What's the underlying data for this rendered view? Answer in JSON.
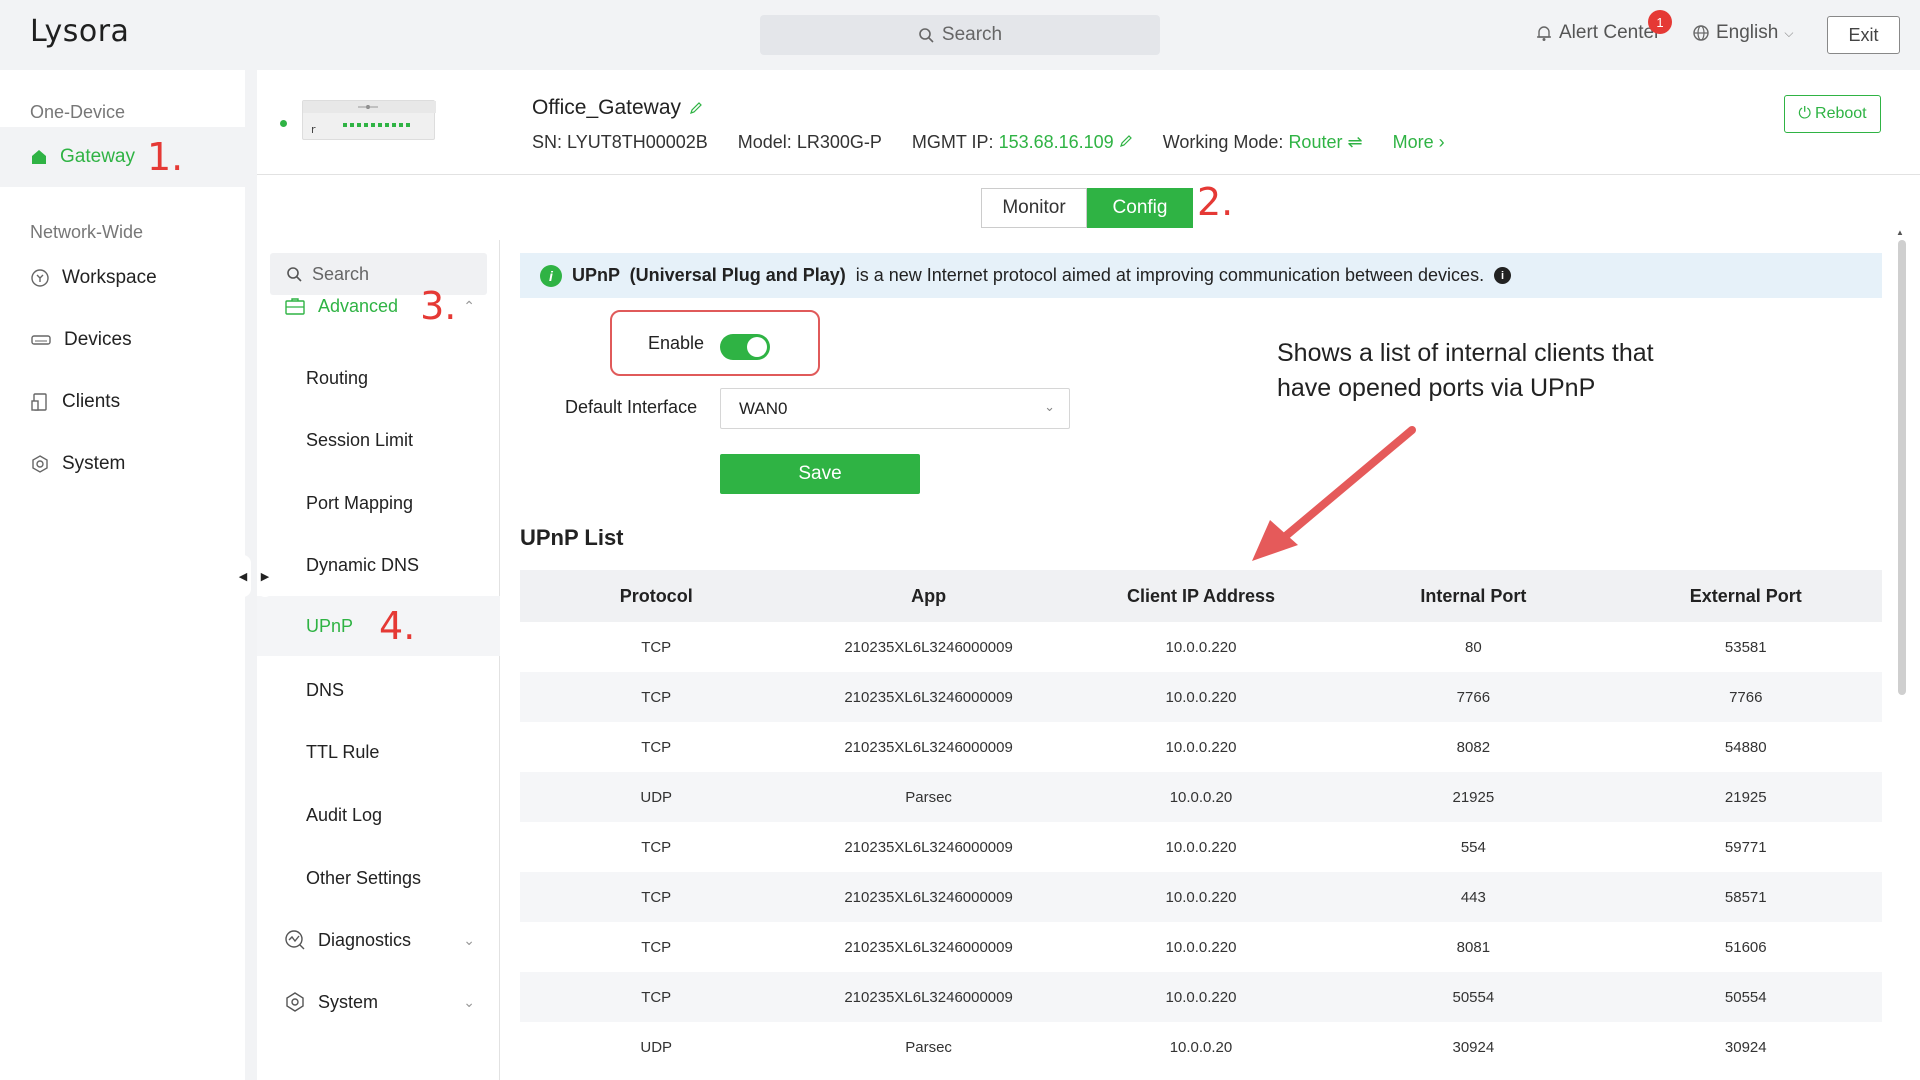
{
  "topbar": {
    "logo": "Lysora",
    "search_placeholder": "Search",
    "alert_label": "Alert Center",
    "alert_count": "1",
    "language": "English",
    "exit_label": "Exit"
  },
  "leftnav": {
    "section_one": "One-Device",
    "gateway": "Gateway",
    "section_network": "Network-Wide",
    "items": [
      {
        "label": "Workspace"
      },
      {
        "label": "Devices"
      },
      {
        "label": "Clients"
      },
      {
        "label": "System"
      }
    ]
  },
  "steps": {
    "s1": "1.",
    "s2": "2.",
    "s3": "3.",
    "s4": "4."
  },
  "device": {
    "name": "Office_Gateway",
    "sn_label": "SN:",
    "sn": "LYUT8TH00002B",
    "model_label": "Model:",
    "model": "LR300G-P",
    "mgmt_label": "MGMT IP:",
    "mgmt_ip": "153.68.16.109",
    "mode_label": "Working Mode:",
    "mode": "Router",
    "more": "More",
    "reboot": "Reboot"
  },
  "tabs": {
    "monitor": "Monitor",
    "config": "Config"
  },
  "subnav": {
    "search_placeholder": "Search",
    "advanced": "Advanced",
    "items": [
      {
        "label": "Routing"
      },
      {
        "label": "Session Limit"
      },
      {
        "label": "Port Mapping"
      },
      {
        "label": "Dynamic DNS"
      },
      {
        "label": "UPnP"
      },
      {
        "label": "DNS"
      },
      {
        "label": "TTL Rule"
      },
      {
        "label": "Audit Log"
      },
      {
        "label": "Other Settings"
      }
    ],
    "diagnostics": "Diagnostics",
    "system": "System"
  },
  "upnp": {
    "banner_bold": "UPnP  (Universal Plug and Play)",
    "banner_text": "is a new Internet protocol aimed at improving communication between devices.",
    "enable_label": "Enable",
    "enabled": true,
    "default_interface_label": "Default Interface",
    "default_interface_value": "WAN0",
    "save_label": "Save",
    "annotation_line1": "Shows a list of internal clients that",
    "annotation_line2": "have opened ports via UPnP",
    "list_title": "UPnP List",
    "columns": [
      "Protocol",
      "App",
      "Client IP Address",
      "Internal Port",
      "External Port"
    ],
    "rows": [
      [
        "TCP",
        "210235XL6L3246000009",
        "10.0.0.220",
        "80",
        "53581"
      ],
      [
        "TCP",
        "210235XL6L3246000009",
        "10.0.0.220",
        "7766",
        "7766"
      ],
      [
        "TCP",
        "210235XL6L3246000009",
        "10.0.0.220",
        "8082",
        "54880"
      ],
      [
        "UDP",
        "Parsec",
        "10.0.0.20",
        "21925",
        "21925"
      ],
      [
        "TCP",
        "210235XL6L3246000009",
        "10.0.0.220",
        "554",
        "59771"
      ],
      [
        "TCP",
        "210235XL6L3246000009",
        "10.0.0.220",
        "443",
        "58571"
      ],
      [
        "TCP",
        "210235XL6L3246000009",
        "10.0.0.220",
        "8081",
        "51606"
      ],
      [
        "TCP",
        "210235XL6L3246000009",
        "10.0.0.220",
        "50554",
        "50554"
      ],
      [
        "UDP",
        "Parsec",
        "10.0.0.20",
        "30924",
        "30924"
      ]
    ]
  },
  "colors": {
    "accent": "#2fb344",
    "annotation_red": "#e53935",
    "banner_bg": "#e6f1f9"
  }
}
